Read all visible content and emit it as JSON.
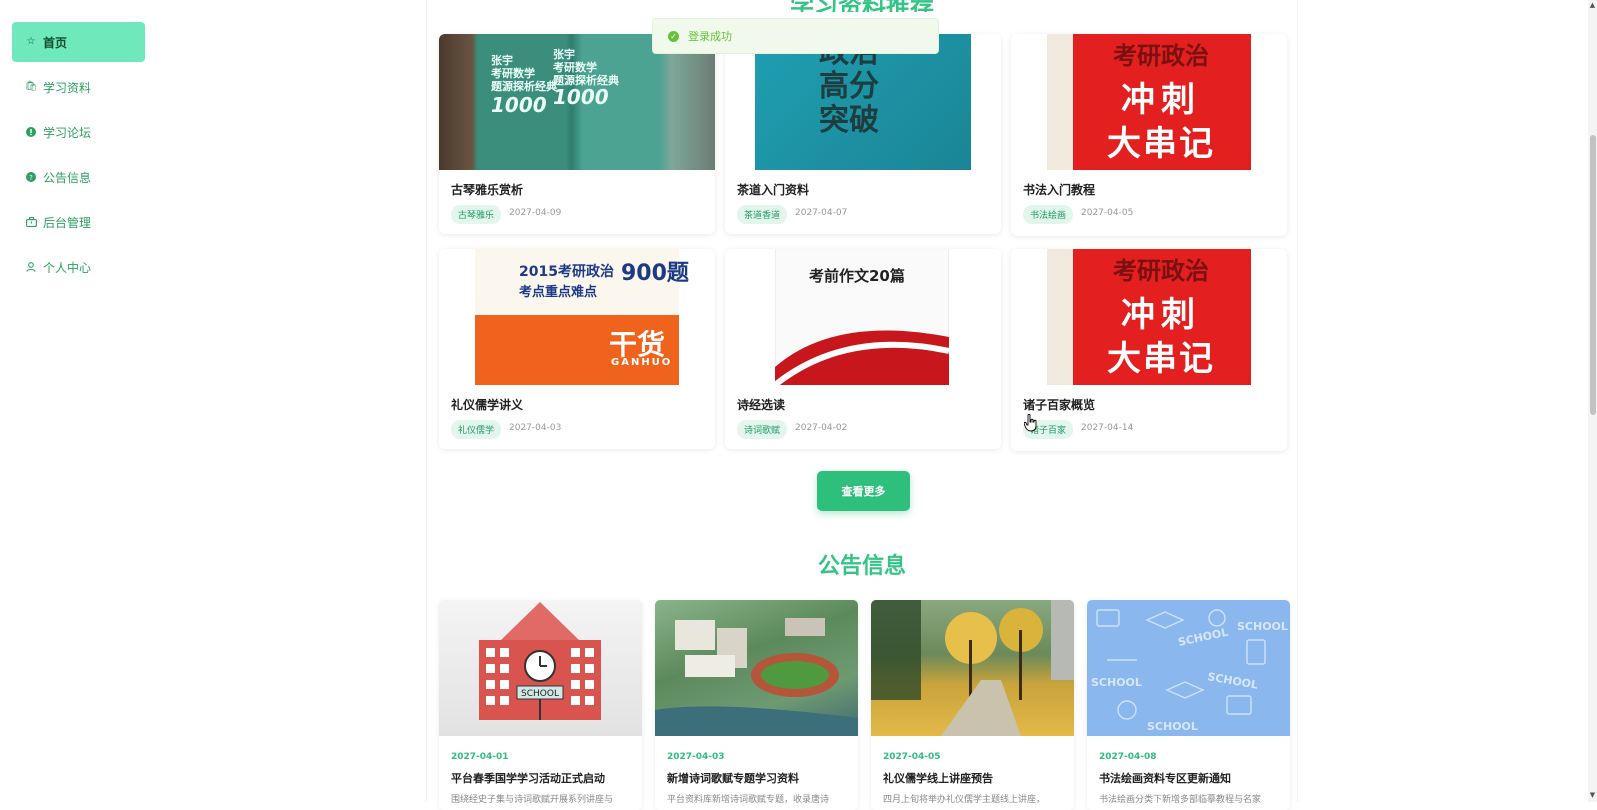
{
  "sidebar": {
    "items": [
      {
        "label": "首页",
        "icon": "star-icon",
        "active": true
      },
      {
        "label": "学习资料",
        "icon": "bag-icon",
        "active": false
      },
      {
        "label": "学习论坛",
        "icon": "info-circle-icon",
        "active": false
      },
      {
        "label": "公告信息",
        "icon": "question-circle-icon",
        "active": false
      },
      {
        "label": "后台管理",
        "icon": "briefcase-icon",
        "active": false
      },
      {
        "label": "个人中心",
        "icon": "user-icon",
        "active": false
      }
    ]
  },
  "toast": {
    "message": "登录成功",
    "icon": "success-check-icon"
  },
  "materials": {
    "heading_partial": "学习资料推荐",
    "items": [
      {
        "title": "古琴雅乐赏析",
        "tag": "古琴雅乐",
        "date": "2027-04-09",
        "cover_lines": [
          "张宇",
          "考研数学",
          "题源探析经典",
          "1000"
        ]
      },
      {
        "title": "茶道入门资料",
        "tag": "茶道香道",
        "date": "2027-04-07",
        "cover_lines": [
          "政治",
          "高分",
          "突破"
        ]
      },
      {
        "title": "书法入门教程",
        "tag": "书法绘画",
        "date": "2027-04-05",
        "cover_lines": [
          "考研政治",
          "冲刺",
          "大串记"
        ]
      },
      {
        "title": "礼仪儒学讲义",
        "tag": "礼仪儒学",
        "date": "2027-04-03",
        "cover_lines": [
          "2015考研政治",
          "考点重点难点",
          "900题",
          "干货",
          "GANHUO"
        ]
      },
      {
        "title": "诗经选读",
        "tag": "诗词歌赋",
        "date": "2027-04-02",
        "cover_lines": [
          "考前作文20篇"
        ]
      },
      {
        "title": "诸子百家概览",
        "tag": "诸子百家",
        "date": "2027-04-14",
        "cover_lines": [
          "考研政治",
          "冲刺",
          "大串记"
        ]
      }
    ],
    "more_label": "查看更多"
  },
  "notices": {
    "heading": "公告信息",
    "items": [
      {
        "date": "2027-04-01",
        "title": "平台春季国学学习活动正式启动",
        "excerpt": "围绕经史子集与诗词歌赋开展系列讲座与"
      },
      {
        "date": "2027-04-03",
        "title": "新增诗词歌赋专题学习资料",
        "excerpt": "平台资料库新增诗词歌赋专题，收录唐诗"
      },
      {
        "date": "2027-04-05",
        "title": "礼仪儒学线上讲座预告",
        "excerpt": "四月上旬将举办礼仪儒学主题线上讲座，"
      },
      {
        "date": "2027-04-08",
        "title": "书法绘画资料专区更新通知",
        "excerpt": "书法绘画分类下新增多部临摹教程与名家"
      }
    ],
    "school_sign": "SCHOOL"
  },
  "colors": {
    "accent": "#2fbf7d",
    "active_nav": "#6fe8bb",
    "heading": "#36c486",
    "tag_bg": "#e2f6ec"
  }
}
